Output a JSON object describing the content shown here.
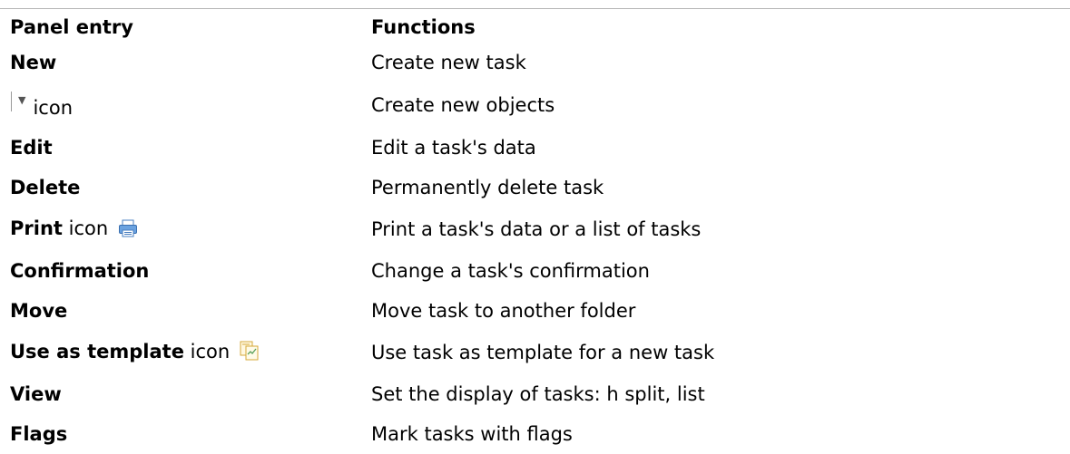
{
  "header": {
    "col1": "Panel entry",
    "col2": "Functions"
  },
  "rows": [
    {
      "name": "New",
      "suffix": "",
      "function": "Create new task"
    },
    {
      "name": "",
      "suffix": "icon",
      "function": "Create new objects"
    },
    {
      "name": "Edit",
      "suffix": "",
      "function": "Edit a task's data"
    },
    {
      "name": "Delete",
      "suffix": "",
      "function": "Permanently delete task"
    },
    {
      "name": "Print",
      "suffix": "icon",
      "function": "Print a task's data or a list of tasks"
    },
    {
      "name": "Confirmation",
      "suffix": "",
      "function": "Change a task's confirmation"
    },
    {
      "name": "Move",
      "suffix": "",
      "function": "Move task to another folder"
    },
    {
      "name": "Use as template",
      "suffix": "icon",
      "function": "Use task as template for a new task"
    },
    {
      "name": "View",
      "suffix": "",
      "function": "Set the display of tasks: h split, list"
    },
    {
      "name": "Flags",
      "suffix": "",
      "function": "Mark tasks with flags"
    }
  ],
  "icons": {
    "row1": "dropdown-arrow-icon",
    "row4": "printer-icon",
    "row7": "template-icon"
  },
  "colors": {
    "rule": "#b5b5b5",
    "printer": "#4a90d9",
    "template": "#e0b040"
  }
}
